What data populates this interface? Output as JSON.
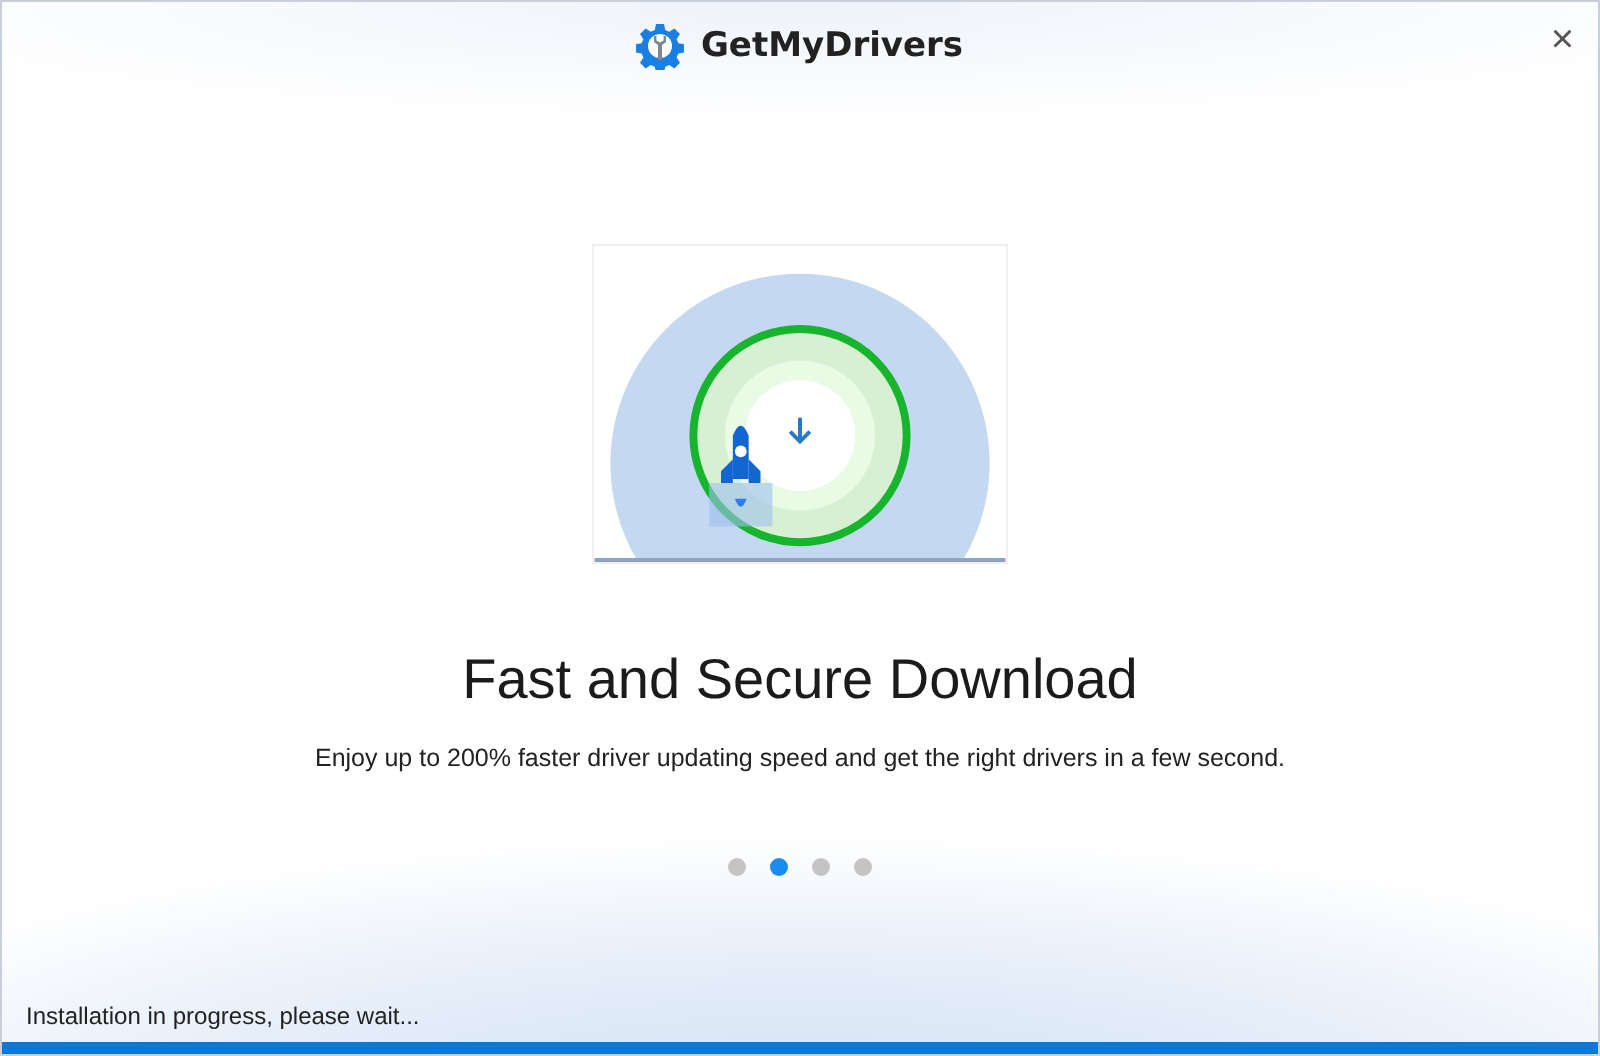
{
  "window": {
    "title": "GetMyDrivers",
    "close": "×"
  },
  "slide": {
    "title": "Fast and Secure Download",
    "description": "Enjoy up to 200% faster driver updating speed and get the right drivers in a few second."
  },
  "pager": [
    {
      "selected": false
    },
    {
      "selected": true
    },
    {
      "selected": false
    },
    {
      "selected": false
    }
  ],
  "status_bar": {
    "text": "Installation in progress, please wait...",
    "progress": {
      "level": 1
    }
  }
}
